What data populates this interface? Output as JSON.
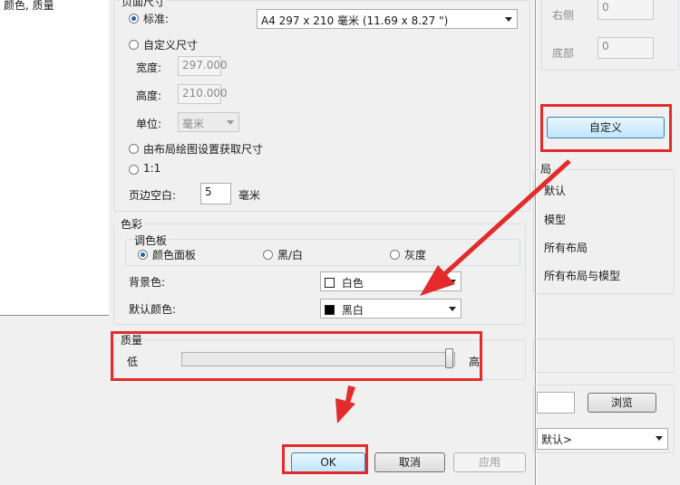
{
  "left_panel": {
    "partial_text": "颜色, 质量"
  },
  "paper_size": {
    "group_title_partial": "页面尺寸",
    "standard_label": "标准:",
    "standard_value": "A4 297 x 210 毫米 (11.69 x 8.27 \")",
    "custom_label": "自定义尺寸",
    "width_label": "宽度:",
    "width_value": "297.000",
    "height_label": "高度:",
    "height_value": "210.000",
    "unit_label": "单位:",
    "unit_value": "毫米",
    "from_layout_label": "由布局绘图设置获取尺寸",
    "one_to_one_label": "1:1",
    "margin_label": "页边空白:",
    "margin_value": "5",
    "margin_unit": "毫米"
  },
  "color": {
    "group_title": "色彩",
    "palette_title": "调色板",
    "palette_color": "颜色面板",
    "palette_bw": "黑/白",
    "palette_gray": "灰度",
    "bg_label": "背景色:",
    "bg_value": "白色",
    "bg_swatch": "#ffffff",
    "default_label": "默认颜色:",
    "default_value": "黑白",
    "default_swatch": "#000000"
  },
  "quality": {
    "group_title": "质量",
    "low_label": "低",
    "high_label": "高",
    "level": 1.0
  },
  "buttons": {
    "ok": "OK",
    "cancel": "取消",
    "apply": "应用"
  },
  "right_panel": {
    "right_label": "右侧",
    "right_value": "0",
    "bottom_label": "底部",
    "bottom_value": "0",
    "custom_button": "自定义",
    "layout_group_partial": "局",
    "layout_items": [
      "默认",
      "模型",
      "所有布局",
      "所有布局与模型"
    ],
    "browse_button": "浏览",
    "default_select": "默认>"
  },
  "annotation_color": "#e32b2b"
}
